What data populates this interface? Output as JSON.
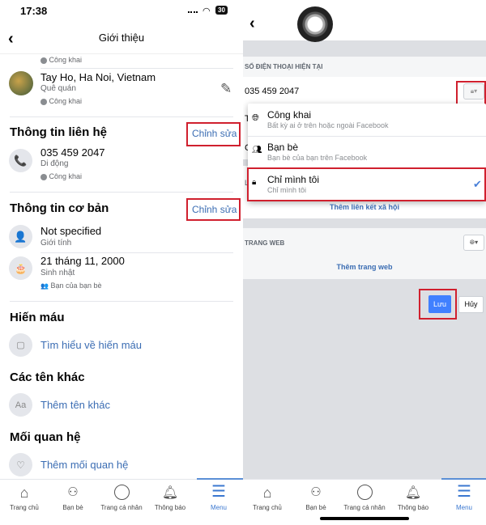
{
  "left": {
    "status": {
      "time": "17:38",
      "battery": "30"
    },
    "header": {
      "title": "Giới thiệu"
    },
    "top_privacy": "Công khai",
    "hometown": {
      "value": "Tay Ho, Ha Noi, Vietnam",
      "label": "Quê quán",
      "privacy": "Công khai"
    },
    "contact": {
      "title": "Thông tin liên hệ",
      "edit": "Chỉnh sửa",
      "phone": "035 459 2047",
      "phone_type": "Di động",
      "privacy": "Công khai"
    },
    "basic": {
      "title": "Thông tin cơ bản",
      "edit": "Chỉnh sửa",
      "gender": "Not specified",
      "gender_label": "Giới tính",
      "birthday": "21 tháng 11, 2000",
      "birthday_label": "Sinh nhật",
      "birthday_privacy": "Bạn của bạn bè"
    },
    "blood": {
      "title": "Hiến máu",
      "link": "Tìm hiểu về hiến máu"
    },
    "names": {
      "title": "Các tên khác",
      "link": "Thêm tên khác",
      "icon_text": "Aa"
    },
    "relationship": {
      "title": "Mối quan hệ",
      "link": "Thêm mối quan hệ"
    }
  },
  "right": {
    "phone_section": {
      "label": "SỐ ĐIỆN THOẠI HIỆN TẠI",
      "phone": "035 459 2047",
      "privacy_icon": "lock-icon"
    },
    "dropdown": {
      "options": [
        {
          "title": "Công khai",
          "sub": "Bất kỳ ai ở trên hoặc ngoài Facebook",
          "icon": "globe-icon"
        },
        {
          "title": "Bạn bè",
          "sub": "Bạn bè của bạn trên Facebook",
          "icon": "friends-icon"
        },
        {
          "title": "Chỉ mình tôi",
          "sub": "Chỉ mình tôi",
          "icon": "lock-icon",
          "selected": true
        }
      ]
    },
    "behind_letters": [
      "T",
      "C",
      "L"
    ],
    "social_link": "Thêm liên kết xã hội",
    "website": {
      "label": "TRANG WEB",
      "link": "Thêm trang web"
    },
    "save": "Lưu",
    "cancel": "Hủy"
  },
  "nav": {
    "items": [
      "Trang chủ",
      "Bạn bè",
      "Trang cá nhân",
      "Thông báo",
      "Menu"
    ],
    "active": "Menu"
  },
  "colors": {
    "accent": "#1877f2",
    "link": "#3b6db3",
    "highlight": "#d0202e",
    "save_button": "#4080ff"
  }
}
